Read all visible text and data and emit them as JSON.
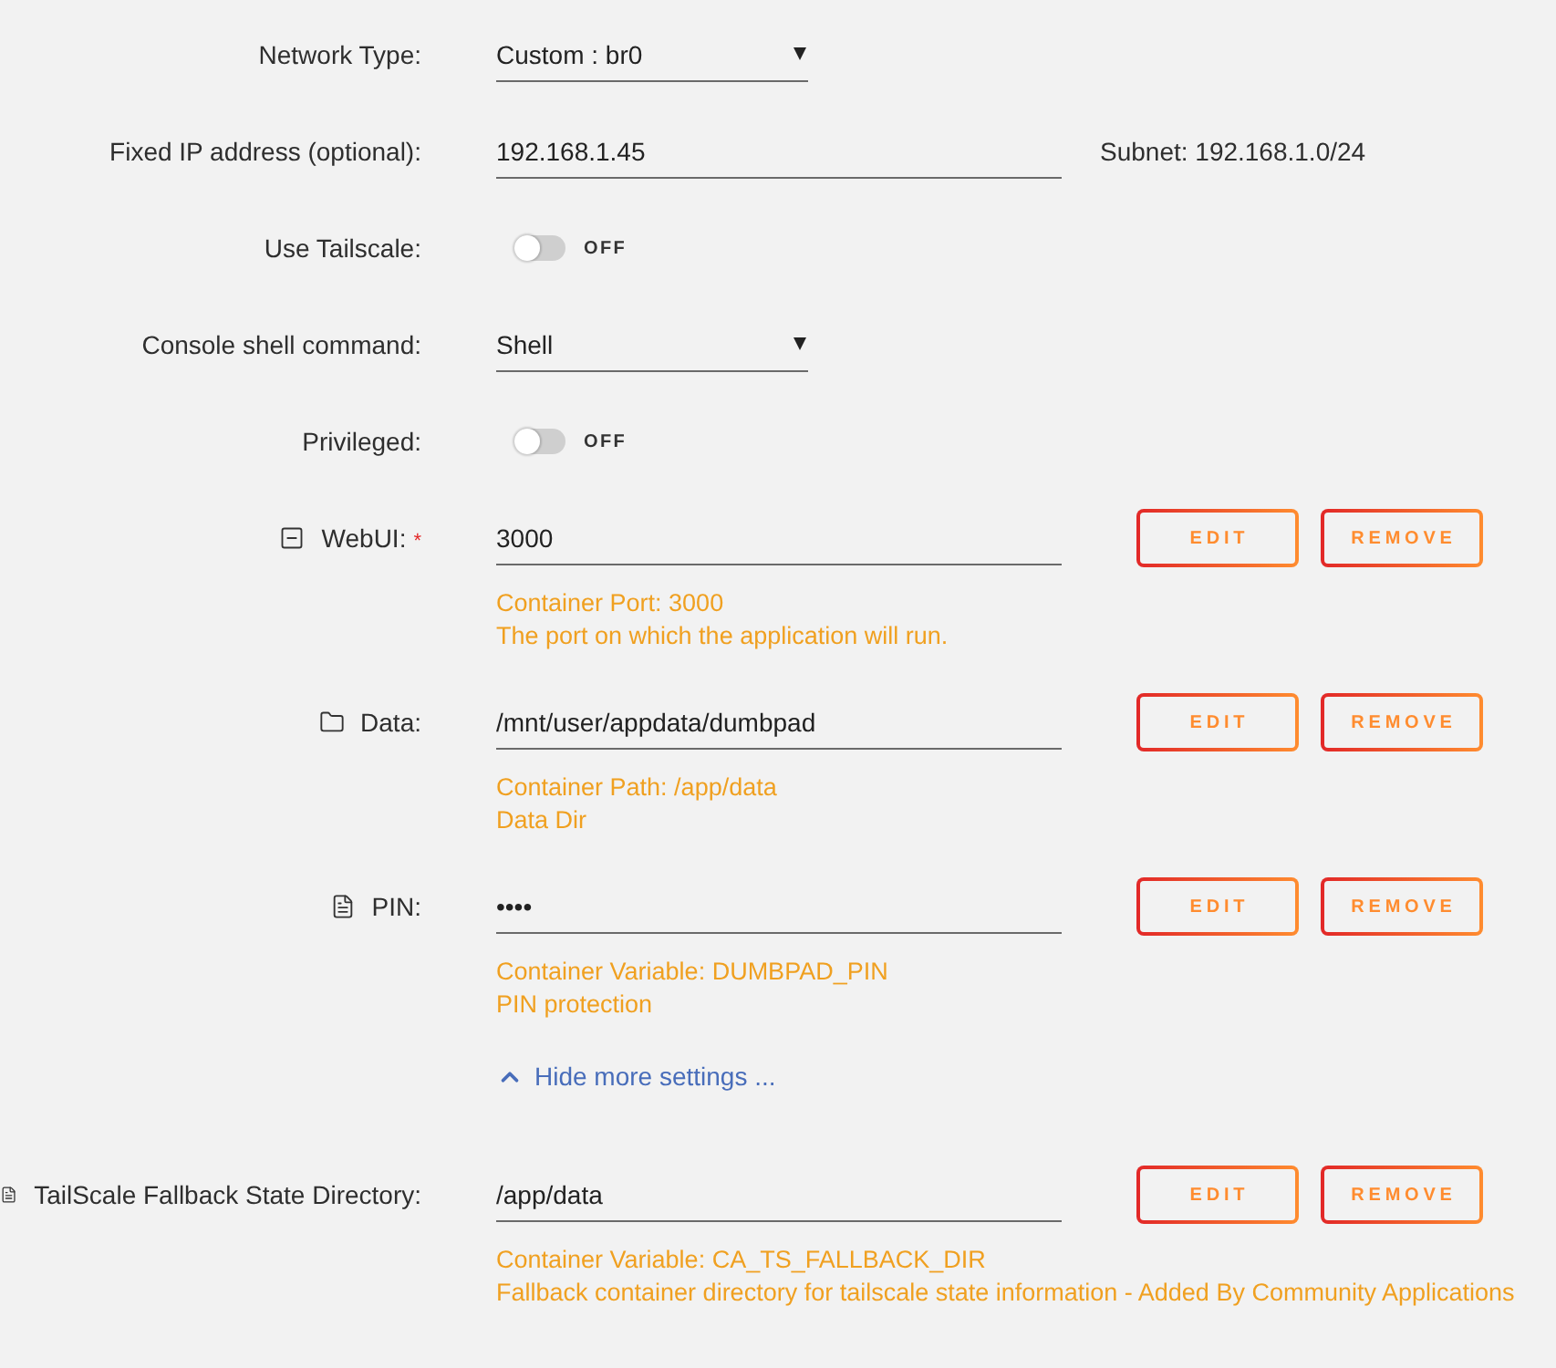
{
  "settings": [
    {
      "kind": "select",
      "label": "Network Type:",
      "value": "Custom : br0"
    },
    {
      "kind": "text",
      "label": "Fixed IP address (optional):",
      "value": "192.168.1.45",
      "note": "Subnet: 192.168.1.0/24"
    },
    {
      "kind": "switch",
      "label": "Use Tailscale:",
      "on": false,
      "state_text": "OFF"
    },
    {
      "kind": "select",
      "label": "Console shell command:",
      "value": "Shell"
    },
    {
      "kind": "switch",
      "label": "Privileged:",
      "on": false,
      "state_text": "OFF"
    }
  ],
  "mappings": [
    {
      "kind": "port",
      "label": "WebUI:",
      "required_mark": "*",
      "value": "3000",
      "details": [
        "Container Port: 3000",
        "The port on which the application will run."
      ],
      "buttons": [
        {
          "label": "EDIT"
        },
        {
          "label": "REMOVE"
        }
      ]
    },
    {
      "kind": "path",
      "label": "Data:",
      "value": "/mnt/user/appdata/dumbpad",
      "details": [
        "Container Path: /app/data",
        "Data Dir"
      ],
      "buttons": [
        {
          "label": "EDIT"
        },
        {
          "label": "REMOVE"
        }
      ]
    },
    {
      "kind": "variable",
      "label": "PIN:",
      "value": "••••",
      "details": [
        "Container Variable: DUMBPAD_PIN",
        "PIN protection"
      ],
      "buttons": [
        {
          "label": "EDIT"
        },
        {
          "label": "REMOVE"
        }
      ]
    }
  ],
  "more_settings_toggle": {
    "label": "Hide more settings ...",
    "expanded": true
  },
  "extra_mappings": [
    {
      "kind": "variable",
      "label": "TailScale Fallback State Directory:",
      "value": "/app/data",
      "details": [
        "Container Variable: CA_TS_FALLBACK_DIR",
        "Fallback container directory for tailscale state information - Added By Community Applications"
      ],
      "buttons": [
        {
          "label": "EDIT"
        },
        {
          "label": "REMOVE"
        }
      ]
    }
  ]
}
